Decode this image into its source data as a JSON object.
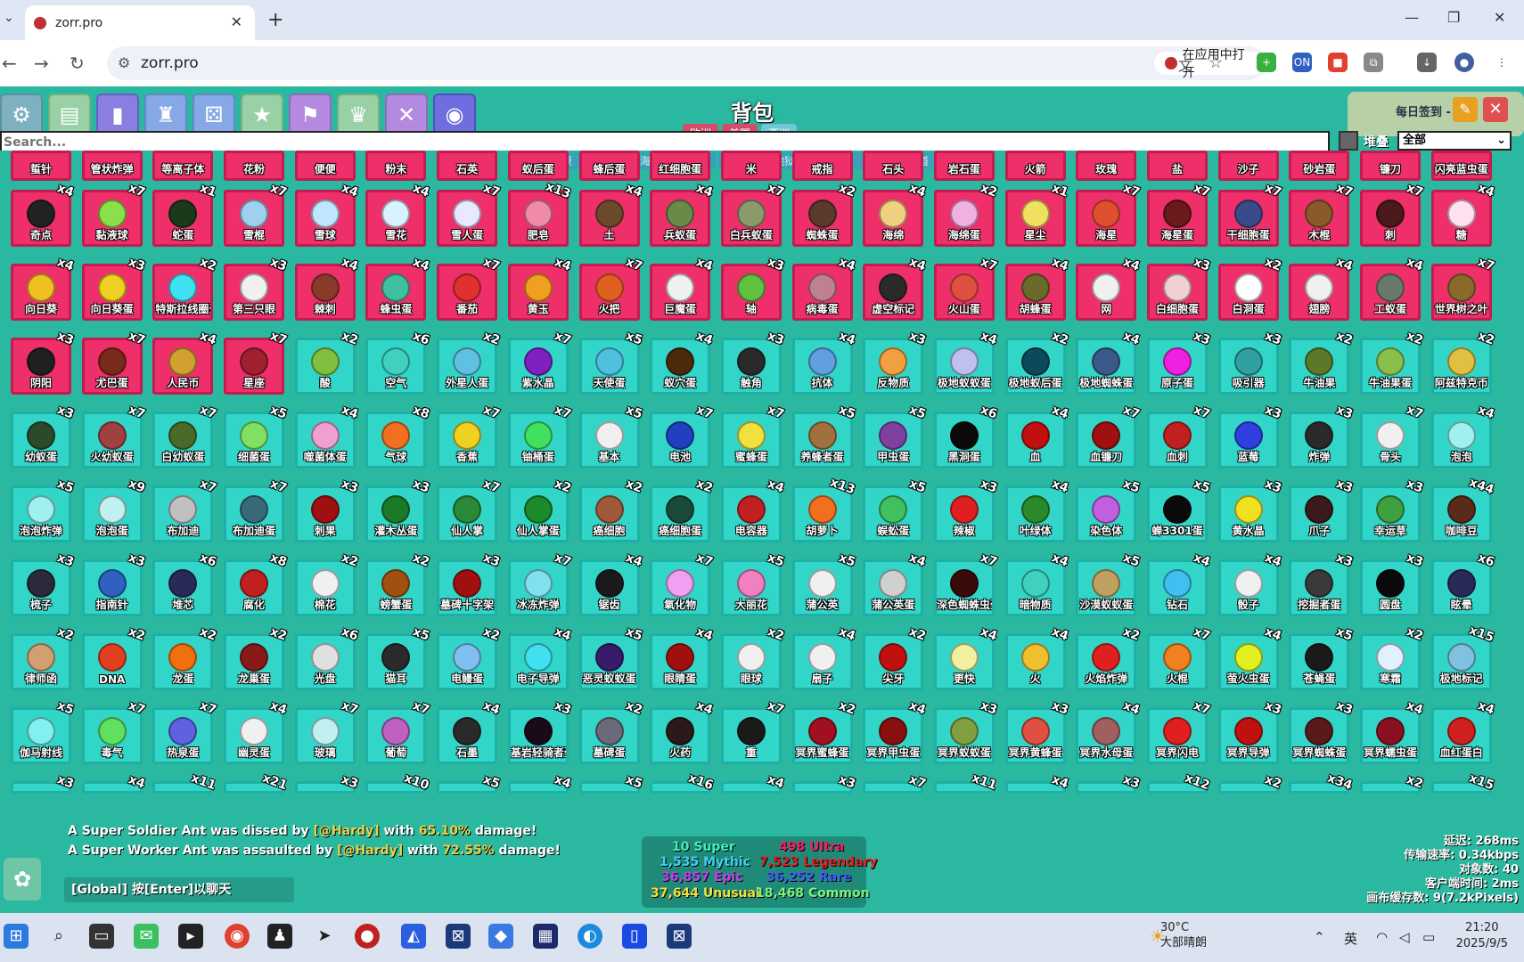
{
  "browser": {
    "tab_title": "zorr.pro",
    "url": "zorr.pro",
    "open_in_app": "在应用中打开",
    "ext_on_label": "ON"
  },
  "game": {
    "title": "背包",
    "region_tabs": [
      "欧洲",
      "美国",
      "亚洲"
    ],
    "active_region": 2,
    "sign_in_label": "每日签到 - 1",
    "search_placeholder": "Search...",
    "stack_label": "堆叠",
    "filter_value": "全部",
    "category_tabs": [
      "平原",
      "沙漠",
      "海洋",
      "丛林",
      "蚁穴",
      "地狱",
      "虚空",
      "冥界",
      "管道"
    ]
  },
  "items_top_row": [
    "蜇针",
    "管状炸弹",
    "等离子体",
    "花粉",
    "便便",
    "粉末",
    "石英",
    "蚁后蛋",
    "蜂后蛋",
    "红细胞蛋",
    "米",
    "戒指",
    "石头",
    "岩石蛋",
    "火箭",
    "玫瑰",
    "盐",
    "沙子",
    "砂岩蛋",
    "镰刀",
    "闪亮蓝虫蛋"
  ],
  "items": [
    [
      {
        "n": "奇点",
        "c": "x4",
        "col": "#222"
      },
      {
        "n": "黏液球",
        "c": "x7",
        "col": "#8be04a"
      },
      {
        "n": "蛇蛋",
        "c": "x1",
        "col": "#1a3a1a"
      },
      {
        "n": "雪棍",
        "c": "x7",
        "col": "#9fd0f0"
      },
      {
        "n": "雪球",
        "c": "x4",
        "col": "#bfe6ff"
      },
      {
        "n": "雪花",
        "c": "x4",
        "col": "#d8f2ff"
      },
      {
        "n": "雪人蛋",
        "c": "x7",
        "col": "#e8e8ff"
      },
      {
        "n": "肥皂",
        "c": "x13",
        "col": "#f08aa8"
      },
      {
        "n": "土",
        "c": "x4",
        "col": "#6a4a2a"
      },
      {
        "n": "兵蚁蛋",
        "c": "x4",
        "col": "#6a8a4a"
      },
      {
        "n": "白兵蚁蛋",
        "c": "x7",
        "col": "#8a9a6a"
      },
      {
        "n": "蜘蛛蛋",
        "c": "x2",
        "col": "#5a3a2a"
      },
      {
        "n": "海绵",
        "c": "x4",
        "col": "#f0d080"
      },
      {
        "n": "海绵蛋",
        "c": "x2",
        "col": "#f0b0e0"
      },
      {
        "n": "星尘",
        "c": "x1",
        "col": "#f0e060"
      },
      {
        "n": "海星",
        "c": "x7",
        "col": "#e05030"
      },
      {
        "n": "海星蛋",
        "c": "x7",
        "col": "#6a1a1a"
      },
      {
        "n": "干细胞蛋",
        "c": "x7",
        "col": "#3a4a8a"
      },
      {
        "n": "木棍",
        "c": "x7",
        "col": "#8a5a2a"
      },
      {
        "n": "刺",
        "c": "x7",
        "col": "#4a1a1a"
      },
      {
        "n": "糖",
        "c": "x4",
        "col": "#ffe0f0"
      }
    ],
    [
      {
        "n": "向日葵",
        "c": "x4",
        "col": "#f0c020"
      },
      {
        "n": "向日葵蛋",
        "c": "x3",
        "col": "#f0d020"
      },
      {
        "n": "特斯拉线圈蛋",
        "c": "x2",
        "col": "#40e0f0"
      },
      {
        "n": "第三只眼",
        "c": "x3",
        "col": "#f0f0f0"
      },
      {
        "n": "棘刺",
        "c": "x4",
        "col": "#8a3a2a"
      },
      {
        "n": "蜂虫蛋",
        "c": "x4",
        "col": "#40c0a0"
      },
      {
        "n": "番茄",
        "c": "x7",
        "col": "#e03030"
      },
      {
        "n": "黄玉",
        "c": "x4",
        "col": "#f0a020"
      },
      {
        "n": "火把",
        "c": "x7",
        "col": "#e06020"
      },
      {
        "n": "巨魔蛋",
        "c": "x4",
        "col": "#f0f0f0"
      },
      {
        "n": "轴",
        "c": "x3",
        "col": "#60c040"
      },
      {
        "n": "病毒蛋",
        "c": "x4",
        "col": "#c08090"
      },
      {
        "n": "虚空标记",
        "c": "x4",
        "col": "#2a2a2a"
      },
      {
        "n": "火山蛋",
        "c": "x7",
        "col": "#e05040"
      },
      {
        "n": "胡蜂蛋",
        "c": "x4",
        "col": "#6a6a2a"
      },
      {
        "n": "网",
        "c": "x4",
        "col": "#f0f0f0"
      },
      {
        "n": "白细胞蛋",
        "c": "x3",
        "col": "#f0d0d0"
      },
      {
        "n": "白洞蛋",
        "c": "x2",
        "col": "#ffffff"
      },
      {
        "n": "翅膀",
        "c": "x4",
        "col": "#f0f0f0"
      },
      {
        "n": "工蚁蛋",
        "c": "x4",
        "col": "#6a7a6a"
      },
      {
        "n": "世界树之叶",
        "c": "x7",
        "col": "#8a6a2a"
      }
    ],
    [
      {
        "n": "阴阳",
        "c": "x3",
        "col": "#202020"
      },
      {
        "n": "尤巴蛋",
        "c": "x7",
        "col": "#7a2a1a"
      },
      {
        "n": "人民币",
        "c": "x4",
        "col": "#d0a030"
      },
      {
        "n": "星座",
        "c": "x7",
        "col": "#a02030"
      },
      {
        "n": "酸",
        "c": "x2",
        "col": "#80c040"
      },
      {
        "n": "空气",
        "c": "x6",
        "col": "#40d0c0"
      },
      {
        "n": "外星人蛋",
        "c": "x2",
        "col": "#60c0e0"
      },
      {
        "n": "紫水晶",
        "c": "x7",
        "col": "#8020c0"
      },
      {
        "n": "天使蛋",
        "c": "x5",
        "col": "#50c0e0"
      },
      {
        "n": "蚁穴蛋",
        "c": "x4",
        "col": "#4a2a0a"
      },
      {
        "n": "触角",
        "c": "x3",
        "col": "#2a2a2a"
      },
      {
        "n": "抗体",
        "c": "x4",
        "col": "#60a0e0"
      },
      {
        "n": "反物质",
        "c": "x3",
        "col": "#f0a040"
      },
      {
        "n": "极地蚁蚁蛋",
        "c": "x4",
        "col": "#c0c0f0"
      },
      {
        "n": "极地蚁后蛋",
        "c": "x2",
        "col": "#0a4a5a"
      },
      {
        "n": "极地蜘蛛蛋",
        "c": "x4",
        "col": "#3a5a8a"
      },
      {
        "n": "原子蛋",
        "c": "x3",
        "col": "#f020e0"
      },
      {
        "n": "吸引器",
        "c": "x3",
        "col": "#30a0a0"
      },
      {
        "n": "牛油果",
        "c": "x2",
        "col": "#5a7a2a"
      },
      {
        "n": "牛油果蛋",
        "c": "x2",
        "col": "#8ac04a"
      },
      {
        "n": "阿兹特克币",
        "c": "x2",
        "col": "#e0c040"
      }
    ],
    [
      {
        "n": "幼蚁蛋",
        "c": "x3",
        "col": "#2a4a2a"
      },
      {
        "n": "火幼蚁蛋",
        "c": "x7",
        "col": "#a04040"
      },
      {
        "n": "白幼蚁蛋",
        "c": "x7",
        "col": "#4a6a2a"
      },
      {
        "n": "细菌蛋",
        "c": "x5",
        "col": "#80e060"
      },
      {
        "n": "噬菌体蛋",
        "c": "x4",
        "col": "#f0a0d0"
      },
      {
        "n": "气球",
        "c": "x8",
        "col": "#f07020"
      },
      {
        "n": "香蕉",
        "c": "x7",
        "col": "#f0d020"
      },
      {
        "n": "铀桶蛋",
        "c": "x7",
        "col": "#40e060"
      },
      {
        "n": "基本",
        "c": "x5",
        "col": "#f0f0f0"
      },
      {
        "n": "电池",
        "c": "x7",
        "col": "#2040c0"
      },
      {
        "n": "蜜蜂蛋",
        "c": "x7",
        "col": "#f0e040"
      },
      {
        "n": "养蜂者蛋",
        "c": "x5",
        "col": "#a07040"
      },
      {
        "n": "甲虫蛋",
        "c": "x5",
        "col": "#8040a0"
      },
      {
        "n": "黑洞蛋",
        "c": "x6",
        "col": "#0a0a0a"
      },
      {
        "n": "血",
        "c": "x4",
        "col": "#c01010"
      },
      {
        "n": "血镰刀",
        "c": "x7",
        "col": "#a01010"
      },
      {
        "n": "血刺",
        "c": "x7",
        "col": "#c02020"
      },
      {
        "n": "蓝莓",
        "c": "x3",
        "col": "#3040e0"
      },
      {
        "n": "炸弹",
        "c": "x3",
        "col": "#2a2a2a"
      },
      {
        "n": "骨头",
        "c": "x7",
        "col": "#f0f0f0"
      },
      {
        "n": "泡泡",
        "c": "x4",
        "col": "#a0f0f0"
      }
    ],
    [
      {
        "n": "泡泡炸弹",
        "c": "x5",
        "col": "#a0f0f0"
      },
      {
        "n": "泡泡蛋",
        "c": "x9",
        "col": "#c0f0f0"
      },
      {
        "n": "布加迪",
        "c": "x7",
        "col": "#c0c0c0"
      },
      {
        "n": "布加迪蛋",
        "c": "x7",
        "col": "#3a6a7a"
      },
      {
        "n": "刺果",
        "c": "x3",
        "col": "#a01010"
      },
      {
        "n": "灌木丛蛋",
        "c": "x3",
        "col": "#1a7a2a"
      },
      {
        "n": "仙人掌",
        "c": "x7",
        "col": "#2a8a3a"
      },
      {
        "n": "仙人掌蛋",
        "c": "x2",
        "col": "#1a8a2a"
      },
      {
        "n": "癌细胞",
        "c": "x2",
        "col": "#a05a3a"
      },
      {
        "n": "癌细胞蛋",
        "c": "x2",
        "col": "#1a4a3a"
      },
      {
        "n": "电容器",
        "c": "x4",
        "col": "#c02020"
      },
      {
        "n": "胡萝卜",
        "c": "x13",
        "col": "#f07020"
      },
      {
        "n": "蜈蚣蛋",
        "c": "x5",
        "col": "#40c060"
      },
      {
        "n": "辣椒",
        "c": "x3",
        "col": "#e02020"
      },
      {
        "n": "叶绿体",
        "c": "x4",
        "col": "#2a8a2a"
      },
      {
        "n": "染色体",
        "c": "x5",
        "col": "#c060e0"
      },
      {
        "n": "蝉3301蛋",
        "c": "x5",
        "col": "#0a0a0a"
      },
      {
        "n": "黄水晶",
        "c": "x3",
        "col": "#f0e020"
      },
      {
        "n": "爪子",
        "c": "x3",
        "col": "#3a1a1a"
      },
      {
        "n": "幸运草",
        "c": "x3",
        "col": "#40a040"
      },
      {
        "n": "咖啡豆",
        "c": "x44",
        "col": "#5a2a1a"
      }
    ],
    [
      {
        "n": "梳子",
        "c": "x3",
        "col": "#2a2a3a"
      },
      {
        "n": "指南针",
        "c": "x3",
        "col": "#3060c0"
      },
      {
        "n": "堆芯",
        "c": "x6",
        "col": "#2a2a5a"
      },
      {
        "n": "腐化",
        "c": "x8",
        "col": "#c02020"
      },
      {
        "n": "棉花",
        "c": "x2",
        "col": "#f0f0f0"
      },
      {
        "n": "螃蟹蛋",
        "c": "x2",
        "col": "#a05010"
      },
      {
        "n": "墓碑十字架",
        "c": "x3",
        "col": "#a01010"
      },
      {
        "n": "冰冻炸弹",
        "c": "x7",
        "col": "#80e0f0"
      },
      {
        "n": "锯齿",
        "c": "x4",
        "col": "#1a1a1a"
      },
      {
        "n": "氧化物",
        "c": "x7",
        "col": "#f0a0f0"
      },
      {
        "n": "大丽花",
        "c": "x5",
        "col": "#f080c0"
      },
      {
        "n": "蒲公英",
        "c": "x5",
        "col": "#f0f0f0"
      },
      {
        "n": "蒲公英蛋",
        "c": "x4",
        "col": "#d0d0d0"
      },
      {
        "n": "深色蜘蛛虫蛋",
        "c": "x7",
        "col": "#3a0a0a"
      },
      {
        "n": "暗物质",
        "c": "x4",
        "col": "#40d0c0"
      },
      {
        "n": "沙漠蚁蚁蛋",
        "c": "x5",
        "col": "#c0a060"
      },
      {
        "n": "钻石",
        "c": "x4",
        "col": "#40c0f0"
      },
      {
        "n": "骰子",
        "c": "x4",
        "col": "#f0f0f0"
      },
      {
        "n": "挖掘者蛋",
        "c": "x3",
        "col": "#3a3a3a"
      },
      {
        "n": "圆盘",
        "c": "x3",
        "col": "#0a0a0a"
      },
      {
        "n": "眩晕",
        "c": "x6",
        "col": "#2a2a5a"
      }
    ],
    [
      {
        "n": "律师函",
        "c": "x2",
        "col": "#d0a070"
      },
      {
        "n": "DNA",
        "c": "x2",
        "col": "#e04020"
      },
      {
        "n": "龙蛋",
        "c": "x2",
        "col": "#f07010"
      },
      {
        "n": "龙巢蛋",
        "c": "x2",
        "col": "#8a1a1a"
      },
      {
        "n": "光盘",
        "c": "x6",
        "col": "#e0e0e0"
      },
      {
        "n": "猫耳",
        "c": "x5",
        "col": "#2a2a2a"
      },
      {
        "n": "电鳗蛋",
        "c": "x2",
        "col": "#80c0f0"
      },
      {
        "n": "电子导弹",
        "c": "x4",
        "col": "#40e0f0"
      },
      {
        "n": "恶灵蚁蚁蛋",
        "c": "x5",
        "col": "#3a1a6a"
      },
      {
        "n": "眼睛蛋",
        "c": "x4",
        "col": "#a01010"
      },
      {
        "n": "眼球",
        "c": "x2",
        "col": "#f0f0f0"
      },
      {
        "n": "扇子",
        "c": "x4",
        "col": "#f0f0f0"
      },
      {
        "n": "尖牙",
        "c": "x2",
        "col": "#c01010"
      },
      {
        "n": "更快",
        "c": "x4",
        "col": "#f0f0a0"
      },
      {
        "n": "火",
        "c": "x4",
        "col": "#f0c030"
      },
      {
        "n": "火焰炸弹",
        "c": "x2",
        "col": "#e02020"
      },
      {
        "n": "火棍",
        "c": "x7",
        "col": "#f08020"
      },
      {
        "n": "萤火虫蛋",
        "c": "x4",
        "col": "#e0f020"
      },
      {
        "n": "苍蝇蛋",
        "c": "x5",
        "col": "#1a1a1a"
      },
      {
        "n": "寒霜",
        "c": "x2",
        "col": "#e0f0ff"
      },
      {
        "n": "极地标记",
        "c": "x15",
        "col": "#80c0e0"
      }
    ],
    [
      {
        "n": "伽马射线",
        "c": "x5",
        "col": "#80f0f0"
      },
      {
        "n": "毒气",
        "c": "x7",
        "col": "#60e060"
      },
      {
        "n": "热泉蛋",
        "c": "x7",
        "col": "#6060e0"
      },
      {
        "n": "幽灵蛋",
        "c": "x4",
        "col": "#f0f0f0"
      },
      {
        "n": "玻璃",
        "c": "x7",
        "col": "#c0f0f0"
      },
      {
        "n": "葡萄",
        "c": "x7",
        "col": "#c060c0"
      },
      {
        "n": "石墨",
        "c": "x4",
        "col": "#2a2a2a"
      },
      {
        "n": "基岩轻骑者蛋",
        "c": "x3",
        "col": "#1a0a1a"
      },
      {
        "n": "墓碑蛋",
        "c": "x2",
        "col": "#6a6a7a"
      },
      {
        "n": "火药",
        "c": "x4",
        "col": "#2a1a1a"
      },
      {
        "n": "重",
        "c": "x7",
        "col": "#1a1a1a"
      },
      {
        "n": "冥界蜜蜂蛋",
        "c": "x2",
        "col": "#a01020"
      },
      {
        "n": "冥界甲虫蛋",
        "c": "x4",
        "col": "#8a1010"
      },
      {
        "n": "冥界蚁蚁蛋",
        "c": "x3",
        "col": "#80a040"
      },
      {
        "n": "冥界黄蜂蛋",
        "c": "x3",
        "col": "#e05040"
      },
      {
        "n": "冥界水母蛋",
        "c": "x4",
        "col": "#a06060"
      },
      {
        "n": "冥界闪电",
        "c": "x7",
        "col": "#e02020"
      },
      {
        "n": "冥界导弹",
        "c": "x3",
        "col": "#c01010"
      },
      {
        "n": "冥界蜘蛛蛋",
        "c": "x3",
        "col": "#5a1a1a"
      },
      {
        "n": "冥界蠕虫蛋",
        "c": "x4",
        "col": "#8a1020"
      },
      {
        "n": "血红蛋白",
        "c": "x4",
        "col": "#d02020"
      }
    ]
  ],
  "bottom_counts": [
    "x3",
    "x4",
    "x11",
    "x21",
    "x3",
    "x10",
    "x5",
    "x4",
    "x5",
    "x16",
    "x4",
    "x3",
    "x7",
    "x11",
    "x4",
    "x3",
    "x12",
    "x2",
    "x34",
    "x2",
    "x15"
  ],
  "chat": {
    "line1_a": "A Super Soldier Ant was dissed by",
    "line1_user": "[@Hardy]",
    "line1_b": "with",
    "line1_pct": "65.10%",
    "line1_c": "damage!",
    "line2_a": "A Super Worker Ant was assaulted by",
    "line2_user": "[@Hardy]",
    "line2_b": "with",
    "line2_pct": "72.55%",
    "line2_c": "damage!",
    "input_hint": "[Global] 按[Enter]以聊天"
  },
  "rarity_counts": {
    "super": "10 Super",
    "ultra": "498 Ultra",
    "mythic": "1,535 Mythic",
    "legendary": "7,523 Legendary",
    "epic": "36,857 Epic",
    "rare": "36,252 Rare",
    "unusual": "37,644 Unusual",
    "common": "18,468 Common",
    "colors": {
      "super": "#40f0c0",
      "ultra": "#f02060",
      "mythic": "#40d0f0",
      "legendary": "#e02020",
      "epic": "#c040f0",
      "rare": "#4060f0",
      "unusual": "#f0e040",
      "common": "#80f080"
    }
  },
  "net_stats": {
    "latency": "延迟: 268ms",
    "transfer": "传输速率: 0.34kbps",
    "objects": "对象数: 40",
    "client_time": "客户端时间: 2ms",
    "cache": "画布缓存数: 9(7.2kPixels)"
  },
  "taskbar": {
    "temp": "30°C",
    "weather": "大部晴朗",
    "ime": "英",
    "time": "21:20",
    "date": "2025/9/5"
  }
}
